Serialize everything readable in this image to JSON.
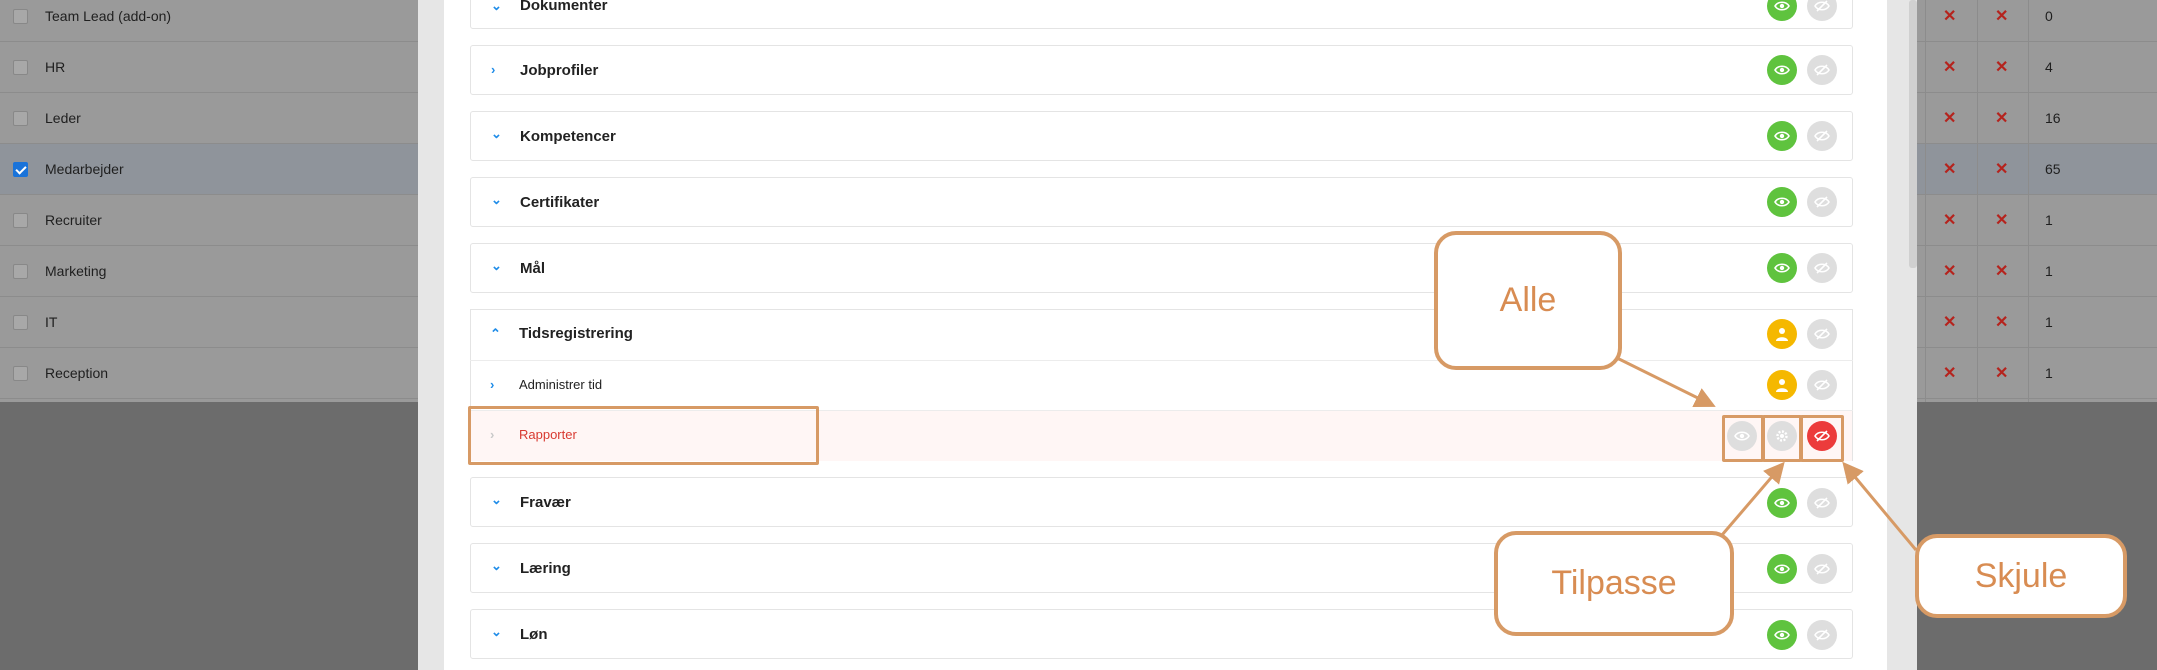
{
  "background_table": {
    "rows": [
      {
        "label": "Team Lead (add-on)",
        "checked": false,
        "x1": "✕",
        "x2": "✕",
        "count": "0"
      },
      {
        "label": "HR",
        "checked": false,
        "x1": "✕",
        "x2": "✕",
        "count": "4"
      },
      {
        "label": "Leder",
        "checked": false,
        "x1": "✕",
        "x2": "✕",
        "count": "16"
      },
      {
        "label": "Medarbejder",
        "checked": true,
        "x1": "✕",
        "x2": "✕",
        "count": "65"
      },
      {
        "label": "Recruiter",
        "checked": false,
        "x1": "✕",
        "x2": "✕",
        "count": "1"
      },
      {
        "label": "Marketing",
        "checked": false,
        "x1": "✕",
        "x2": "✕",
        "count": "1"
      },
      {
        "label": "IT",
        "checked": false,
        "x1": "✕",
        "x2": "✕",
        "count": "1"
      },
      {
        "label": "Reception",
        "checked": false,
        "x1": "✕",
        "x2": "✕",
        "count": "1"
      }
    ]
  },
  "modal": {
    "rows": [
      {
        "title": "Dokumenter",
        "state": "all"
      },
      {
        "title": "Jobprofiler",
        "state": "all"
      },
      {
        "title": "Kompetencer",
        "state": "all"
      },
      {
        "title": "Certifikater",
        "state": "all"
      },
      {
        "title": "Mål",
        "state": "all"
      },
      {
        "title": "Tidsregistrering",
        "state": "custom",
        "expanded": true
      },
      {
        "title": "Administrer tid",
        "state": "custom"
      },
      {
        "title": "Rapporter",
        "state": "hidden"
      },
      {
        "title": "Fravær",
        "state": "all"
      },
      {
        "title": "Læring",
        "state": "all"
      },
      {
        "title": "Løn",
        "state": "all"
      }
    ]
  },
  "callouts": {
    "alle": "Alle",
    "tilpasse": "Tilpasse",
    "skjule": "Skjule"
  },
  "icons": {
    "visible": "eye-icon",
    "hidden": "eye-slash-icon",
    "custom": "person-icon",
    "settings": "gear-icon",
    "collapsed": "chevron-right-icon",
    "expanded": "chevron-up-icon"
  },
  "colors": {
    "green": "#5fc33e",
    "yellow": "#f5b800",
    "red": "#ec3b3b",
    "accent": "#1f8ce8",
    "annotation": "#d79a65"
  }
}
